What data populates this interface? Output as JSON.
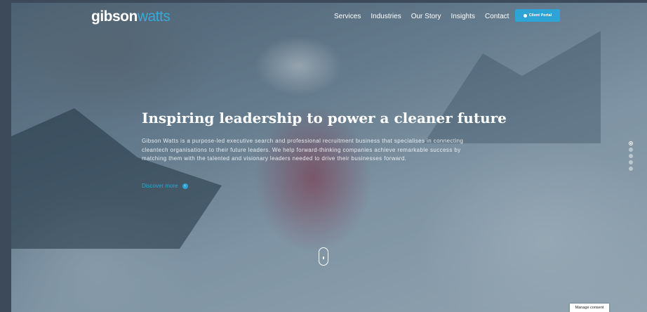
{
  "brand": {
    "part1": "gibson",
    "part2": "watts"
  },
  "nav": {
    "items": [
      "Services",
      "Industries",
      "Our Story",
      "Insights",
      "Contact"
    ]
  },
  "client_portal": {
    "label": "Client Portal"
  },
  "hero": {
    "headline": "Inspiring leadership to power a cleaner future",
    "paragraph": "Gibson Watts is a purpose-led executive search and professional recruitment business that specialises in connecting cleantech organisations to their future leaders. We help forward-thinking companies achieve remarkable success by matching them with the talented and visionary leaders needed to drive their businesses forward.",
    "cta_label": "Discover more",
    "slider": {
      "count": 5,
      "active_index": 0
    }
  },
  "consent": {
    "label": "Manage consent"
  },
  "icons": {
    "user": "user-icon",
    "arrow": "arrow-right-icon",
    "scroll": "mouse-scroll-icon"
  }
}
